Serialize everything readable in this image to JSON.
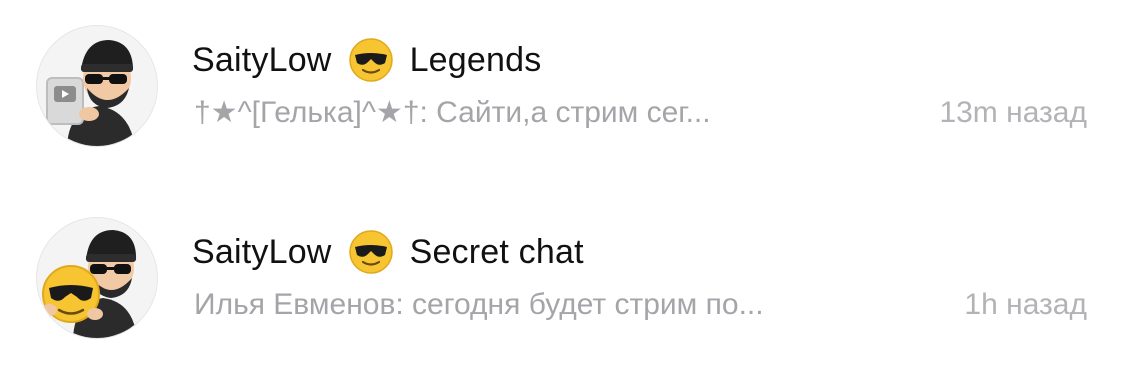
{
  "chats": [
    {
      "name": "SaityLow",
      "emoji_icon": "sunglasses-emoji-icon",
      "group": "Legends",
      "preview": "†★^[Гелька]^★†: Сайти,а стрим сег...",
      "time": "13m назад"
    },
    {
      "name": "SaityLow",
      "emoji_icon": "sunglasses-emoji-icon",
      "group": "Secret chat",
      "preview": "Илья Евменов: сегодня будет стрим по...",
      "time": "1h назад"
    }
  ],
  "colors": {
    "title": "#111111",
    "preview": "#a5a5a9",
    "time": "#b3b3b7",
    "emoji_yellow": "#f7c531",
    "avatar_bg": "#f2f2f2"
  }
}
